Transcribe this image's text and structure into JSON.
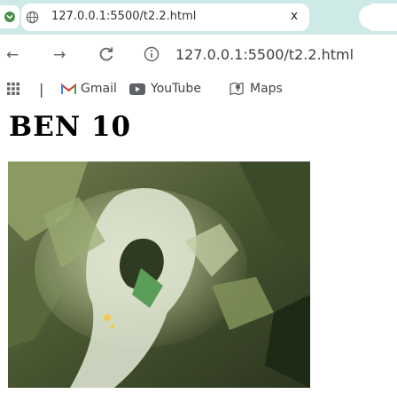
{
  "browser": {
    "tab": {
      "title": "127.0.0.1:5500/t2.2.html",
      "close_glyph": "x"
    },
    "address_bar": {
      "url": "127.0.0.1:5500/t2.2.html"
    },
    "bookmarks": [
      {
        "label": "Gmail",
        "icon": "gmail-icon"
      },
      {
        "label": "YouTube",
        "icon": "youtube-icon"
      },
      {
        "label": "Maps",
        "icon": "maps-icon"
      }
    ],
    "bookmark_divider": "|"
  },
  "page": {
    "heading": "BEN 10",
    "image": {
      "subject": "ben-10-photo"
    }
  },
  "colors": {
    "tabstrip_bg": "#cdeae6",
    "accent_green": "#5a9e5a"
  }
}
